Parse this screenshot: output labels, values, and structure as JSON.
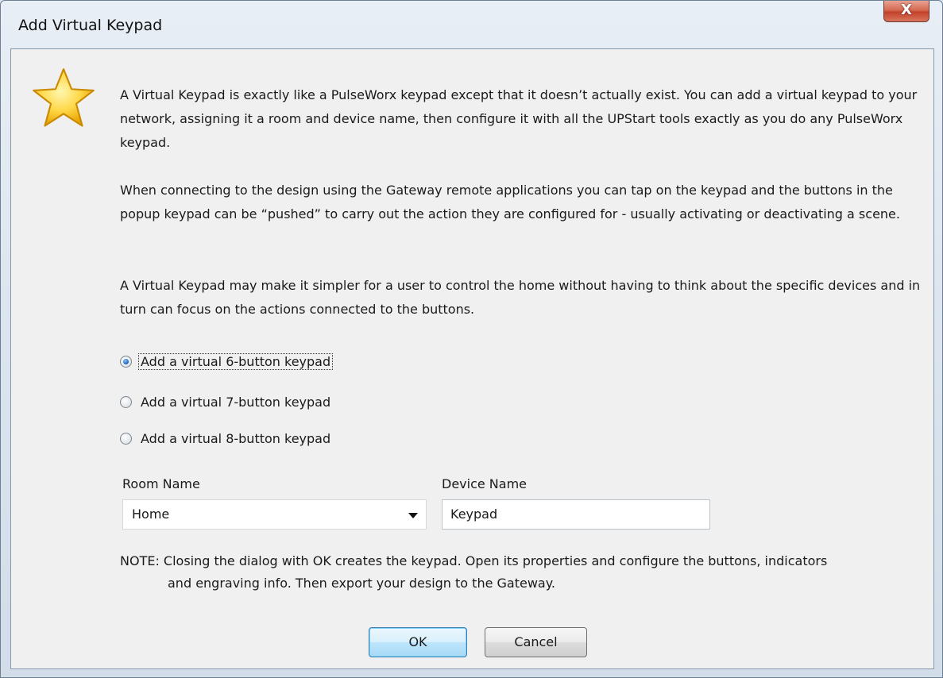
{
  "window": {
    "title": "Add Virtual Keypad",
    "close_label": "X"
  },
  "intro": {
    "paragraph1": "A Virtual Keypad is exactly like a PulseWorx keypad except that it doesn’t actually exist. You can add a virtual keypad to your network, assigning it a room and device name,  then configure it with all the UPStart tools exactly as you do any PulseWorx keypad.",
    "paragraph2": "When connecting to the design using the Gateway remote applications you can tap on the keypad and the buttons in the popup keypad can be “pushed” to carry out the action they are configured for - usually activating or deactivating a scene.",
    "paragraph3": "A Virtual Keypad may make it simpler for a user to control the home without having to think about the specific devices and in turn can focus on the actions connected to the buttons."
  },
  "options": [
    {
      "label": "Add a virtual 6-button keypad",
      "checked": true
    },
    {
      "label": "Add a virtual 7-button keypad",
      "checked": false
    },
    {
      "label": "Add a virtual 8-button keypad",
      "checked": false
    }
  ],
  "room": {
    "label": "Room Name",
    "value": "Home"
  },
  "device": {
    "label": "Device Name",
    "value": "Keypad"
  },
  "note": {
    "line1": "NOTE: Closing the dialog with OK creates the keypad. Open its properties and configure the buttons, indicators",
    "line2": "and engraving info. Then export your design to the Gateway."
  },
  "buttons": {
    "ok": "OK",
    "cancel": "Cancel"
  },
  "icon": "star-icon"
}
